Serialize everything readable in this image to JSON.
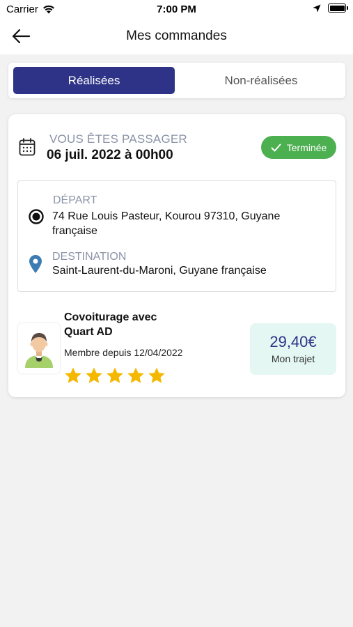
{
  "status_bar": {
    "carrier": "Carrier",
    "time": "7:00 PM"
  },
  "header": {
    "title": "Mes commandes",
    "back_icon": "arrow-left-icon"
  },
  "tabs": [
    {
      "label": "Réalisées",
      "active": true
    },
    {
      "label": "Non-réalisées",
      "active": false
    }
  ],
  "order": {
    "role": "VOUS ÊTES PASSAGER",
    "date": "06 juil. 2022 à 00h00",
    "status": "Terminée",
    "status_color": "#4caf50",
    "origin": {
      "label": "DÉPART",
      "address": "74 Rue Louis Pasteur, Kourou 97310, Guyane française"
    },
    "destination": {
      "label": "DESTINATION",
      "address": "Saint-Laurent-du-Maroni, Guyane française"
    },
    "driver": {
      "title": "Covoiturage avec Quart AD",
      "member_since": "Membre depuis 12/04/2022",
      "rating": 5,
      "rating_max": 5
    },
    "price": {
      "value": "29,40€",
      "label": "Mon trajet"
    }
  },
  "colors": {
    "accent": "#2e3388",
    "muted_label": "#8a93a6",
    "price_bg": "#e4f7f2",
    "star": "#f5b800"
  }
}
